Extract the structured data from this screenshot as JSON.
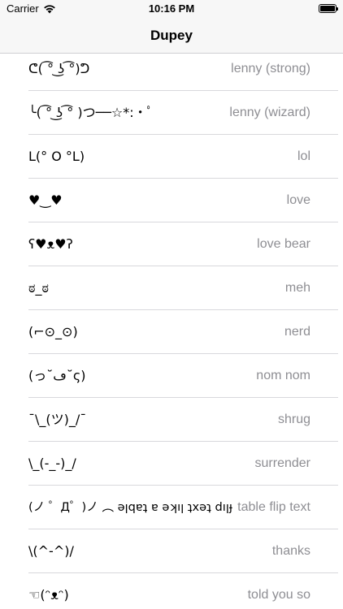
{
  "status_bar": {
    "carrier": "Carrier",
    "time": "10:16 PM"
  },
  "nav": {
    "title": "Dupey"
  },
  "items": [
    {
      "face": "ᕦ( ͡° ͜ʖ ͡°)ᕤ",
      "name": "lenny (strong)"
    },
    {
      "face": "╰( ͡° ͜ʖ ͡° )つ──☆*:・ﾟ",
      "name": "lenny (wizard)"
    },
    {
      "face": "L(° O °L)",
      "name": "lol"
    },
    {
      "face": "♥‿♥",
      "name": "love"
    },
    {
      "face": "ʕ♥ᴥ♥ʔ",
      "name": "love bear"
    },
    {
      "face": "ಠ_ಠ",
      "name": "meh"
    },
    {
      "face": "(⌐⊙_⊙)",
      "name": "nerd"
    },
    {
      "face": "(っ˘ڡ˘ς)",
      "name": "nom nom"
    },
    {
      "face": "¯\\_(ツ)_/¯",
      "name": "shrug"
    },
    {
      "face": "\\_(-_-)_/",
      "name": "surrender"
    },
    {
      "face": "(ノ ゜Д゜)ノ ︵ ǝןqɐʇ ɐ ǝʞıן ʇxǝʇ dıןɟ",
      "name": "table flip text"
    },
    {
      "face": "\\(^-^)/",
      "name": "thanks"
    },
    {
      "face": "☜(ᵔᴥᵔ)",
      "name": "told you so"
    }
  ]
}
